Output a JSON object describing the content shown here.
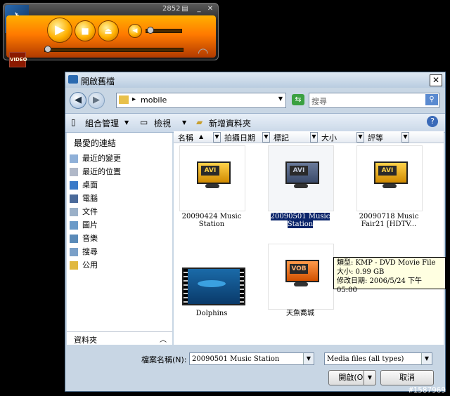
{
  "player": {
    "counter": "2852",
    "video_label": "VIDEO",
    "progress": 0.0,
    "volume": 0.05
  },
  "dialog": {
    "title": "開啟舊檔",
    "address": "mobile",
    "search_placeholder": "搜尋",
    "toolbar": {
      "organize": "組合管理",
      "views": "檢視",
      "new_folder": "新增資料夾"
    },
    "favorites_header": "最愛的連結",
    "favorites": [
      "最近的變更",
      "最近的位置",
      "桌面",
      "電腦",
      "文件",
      "圖片",
      "音樂",
      "搜尋",
      "公用"
    ],
    "folders_label": "資料夾",
    "columns": [
      "名稱",
      "拍攝日期",
      "標記",
      "大小",
      "評等"
    ],
    "files": [
      {
        "name_line1": "20090424 Music",
        "name_line2": "Station",
        "badge": "AVI",
        "selected": false
      },
      {
        "name_line1": "20090501 Music",
        "name_line2": "Station",
        "badge": "AVI",
        "selected": true
      },
      {
        "name_line1": "20090718 Music",
        "name_line2": "Fair21 [HDTV...",
        "badge": "AVI",
        "selected": false
      },
      {
        "name_line1": "Dolphins",
        "name_line2": "",
        "badge": "",
        "selected": false
      },
      {
        "name_line1": "天魚喬城",
        "name_line2": "",
        "badge": "VOB",
        "selected": false
      }
    ],
    "tooltip": {
      "type": "類型: KMP - DVD Movie File",
      "size": "大小: 0.99 GB",
      "modified": "修改日期: 2006/5/24 下午 05:00"
    },
    "filename_label": "檔案名稱(N):",
    "filename_value": "20090501 Music Station",
    "filter_value": "Media files (all types)",
    "open_button": "開啟(O)",
    "cancel_button": "取消"
  },
  "watermark": "#1587969",
  "colors": {
    "accent": "#ff8c00",
    "selection": "#0a246a"
  }
}
